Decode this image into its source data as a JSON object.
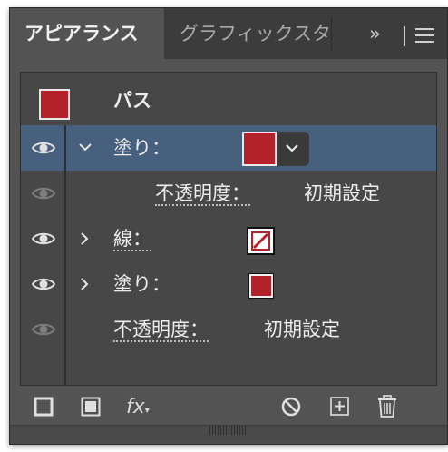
{
  "tabs": {
    "active": "アピアランス",
    "inactive": "グラフィックスタ",
    "overflow": "»"
  },
  "colors": {
    "accent_fill": "#b22228",
    "selected_row": "#46607e",
    "panel_bg": "#535353"
  },
  "list": {
    "header": {
      "title": "パス"
    },
    "rows": [
      {
        "type": "fill",
        "label": "塗り：",
        "expanded": true,
        "selected": true
      },
      {
        "type": "opacity",
        "label": "不透明度：",
        "value": "初期設定"
      },
      {
        "type": "stroke",
        "label": "線：",
        "expanded": false
      },
      {
        "type": "fill",
        "label": "塗り：",
        "expanded": false
      },
      {
        "type": "opacity",
        "label": "不透明度：",
        "value": "初期設定"
      }
    ]
  },
  "icons": {
    "eye": "eye-icon",
    "chevron_down": "chevron-down-icon",
    "chevron_right": "chevron-right-icon",
    "panel_menu": "hamburger-menu-icon",
    "fx": "fx"
  },
  "bottom_toolbar": {
    "fx_label": "fx"
  }
}
